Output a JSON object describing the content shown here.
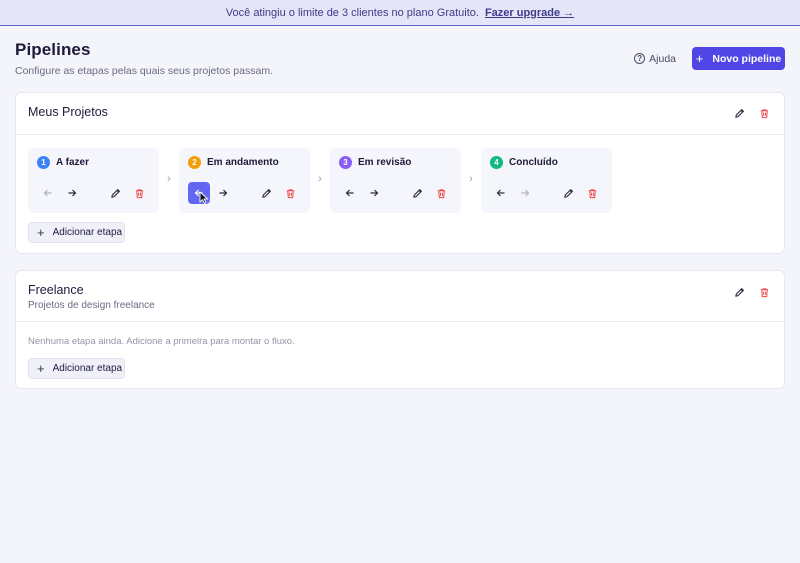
{
  "banner": {
    "text": "Você atingiu o limite de 3 clientes no plano Gratuito.",
    "link": "Fazer upgrade →"
  },
  "header": {
    "title": "Pipelines",
    "subtitle": "Configure as etapas pelas quais seus projetos passam.",
    "help_label": "Ajuda",
    "new_pipeline_label": "Novo pipeline"
  },
  "pipelines": [
    {
      "title": "Meus Projetos",
      "description": "",
      "stages": [
        {
          "number": "1",
          "name": "A fazer",
          "color": "#3b82f6"
        },
        {
          "number": "2",
          "name": "Em andamento",
          "color": "#f59e0b"
        },
        {
          "number": "3",
          "name": "Em revisão",
          "color": "#8b5cf6"
        },
        {
          "number": "4",
          "name": "Concluído",
          "color": "#10b981"
        }
      ],
      "add_stage_label": "Adicionar etapa"
    },
    {
      "title": "Freelance",
      "description": "Projetos de design freelance",
      "empty_text": "Nenhuma etapa ainda. Adicione a primeira para montar o fluxo.",
      "add_stage_label": "Adicionar etapa"
    }
  ],
  "colors": {
    "primary": "#4f46e5",
    "danger": "#ef4444",
    "active_control": "#6366f1"
  }
}
